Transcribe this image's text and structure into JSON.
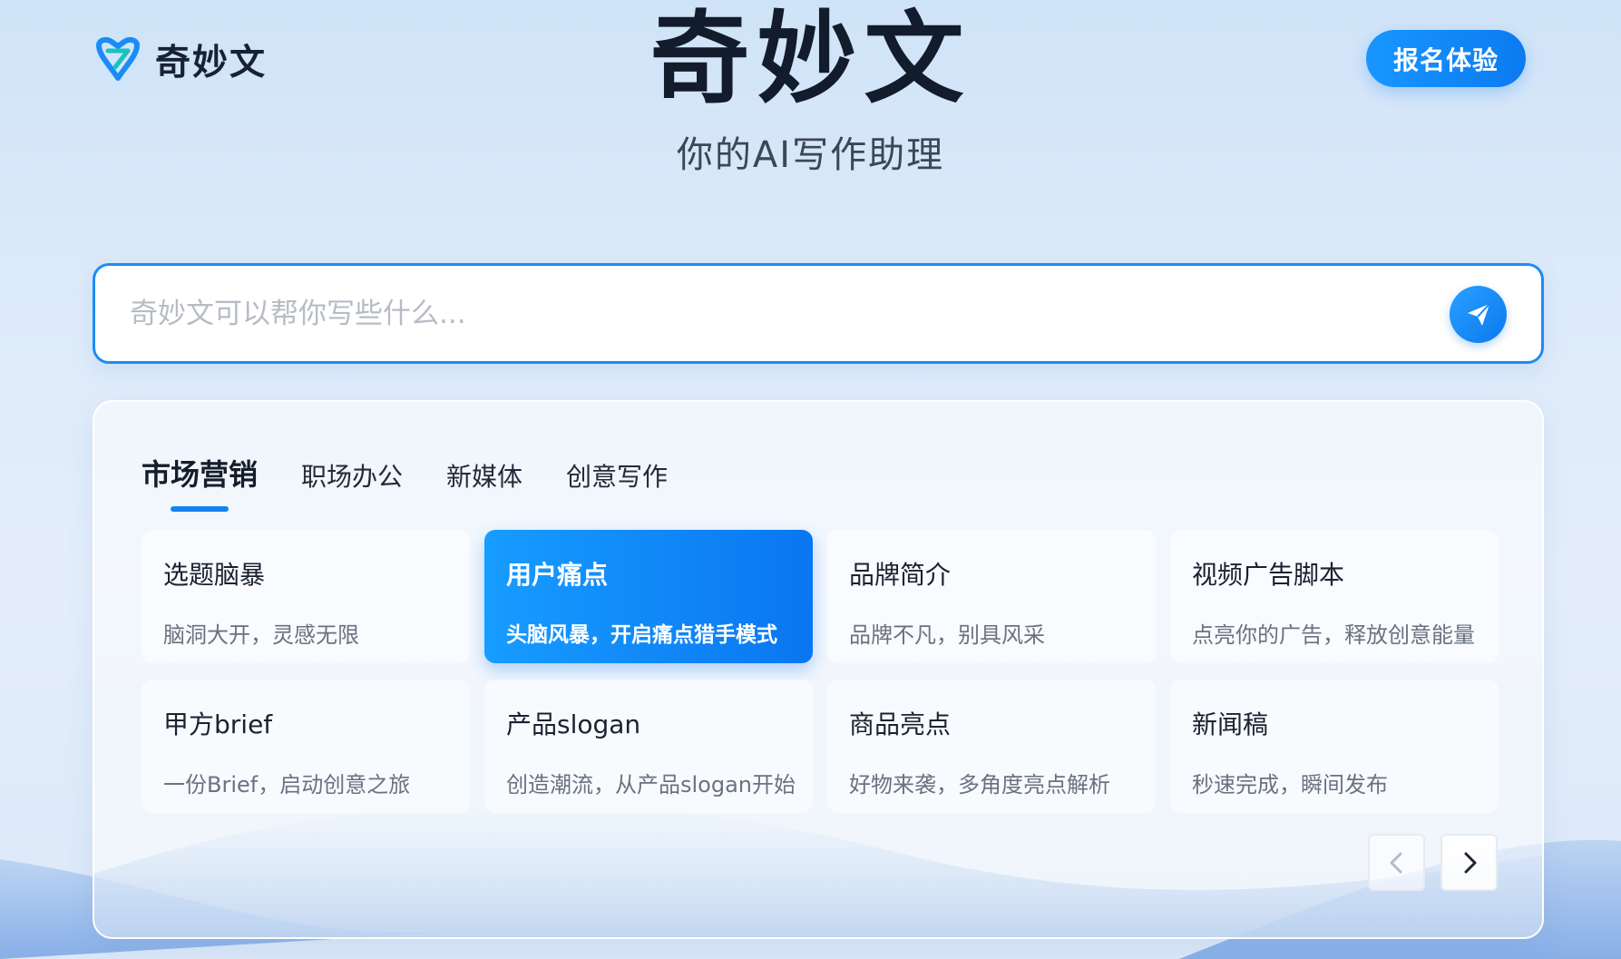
{
  "header": {
    "logo_text": "奇妙文",
    "signup_label": "报名体验"
  },
  "hero": {
    "title": "奇妙文",
    "subtitle": "你的AI写作助理"
  },
  "search": {
    "placeholder": "奇妙文可以帮你写些什么..."
  },
  "tabs": [
    {
      "label": "市场营销",
      "active": true
    },
    {
      "label": "职场办公",
      "active": false
    },
    {
      "label": "新媒体",
      "active": false
    },
    {
      "label": "创意写作",
      "active": false
    }
  ],
  "cards": [
    {
      "title": "选题脑暴",
      "desc": "脑洞大开，灵感无限",
      "active": false
    },
    {
      "title": "用户痛点",
      "desc": "头脑风暴，开启痛点猎手模式",
      "active": true
    },
    {
      "title": "品牌简介",
      "desc": "品牌不凡，别具风采",
      "active": false
    },
    {
      "title": "视频广告脚本",
      "desc": "点亮你的广告，释放创意能量",
      "active": false
    },
    {
      "title": "甲方brief",
      "desc": "一份Brief，启动创意之旅",
      "active": false
    },
    {
      "title": "产品slogan",
      "desc": "创造潮流，从产品slogan开始",
      "active": false
    },
    {
      "title": "商品亮点",
      "desc": "好物来袭，多角度亮点解析",
      "active": false
    },
    {
      "title": "新闻稿",
      "desc": "秒速完成，瞬间发布",
      "active": false
    }
  ],
  "icons": {
    "logo": "qimiaowen-logo-icon",
    "send": "paper-plane-icon",
    "prev": "chevron-left-icon",
    "next": "chevron-right-icon"
  },
  "colors": {
    "accent": "#1583f2",
    "title": "#121c2c"
  }
}
